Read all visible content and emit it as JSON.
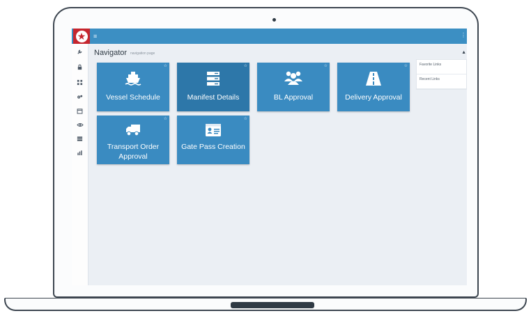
{
  "app": {
    "menu_glyph": "≡",
    "logo_glyph": "★"
  },
  "page": {
    "title": "Navigator",
    "subtitle": "navigation page"
  },
  "tiles": [
    {
      "label": "Vessel Schedule",
      "icon": "ship-icon",
      "active": false
    },
    {
      "label": "Manifest Details",
      "icon": "server-list-icon",
      "active": true
    },
    {
      "label": "BL Approval",
      "icon": "users-group-icon",
      "active": false
    },
    {
      "label": "Delivery Approval",
      "icon": "road-icon",
      "active": false
    },
    {
      "label": "Transport Order Approval",
      "icon": "truck-icon",
      "active": false
    },
    {
      "label": "Gate Pass Creation",
      "icon": "id-card-icon",
      "active": false
    }
  ],
  "tile_star_glyph": "☆",
  "side_panel": {
    "items": [
      "Favorite Links",
      "Recent Links"
    ]
  },
  "sidebar_icons": [
    "wrench-icon",
    "lock-icon",
    "ship-grid-icon",
    "cogs-icon",
    "calendar-icon",
    "eye-icon",
    "table-icon",
    "chart-icon"
  ],
  "colors": {
    "topbar": "#3c8fc3",
    "tile": "#3a8bc1",
    "tile_active": "#2d77a9",
    "logo": "#c6262e",
    "background": "#ebeff4"
  }
}
